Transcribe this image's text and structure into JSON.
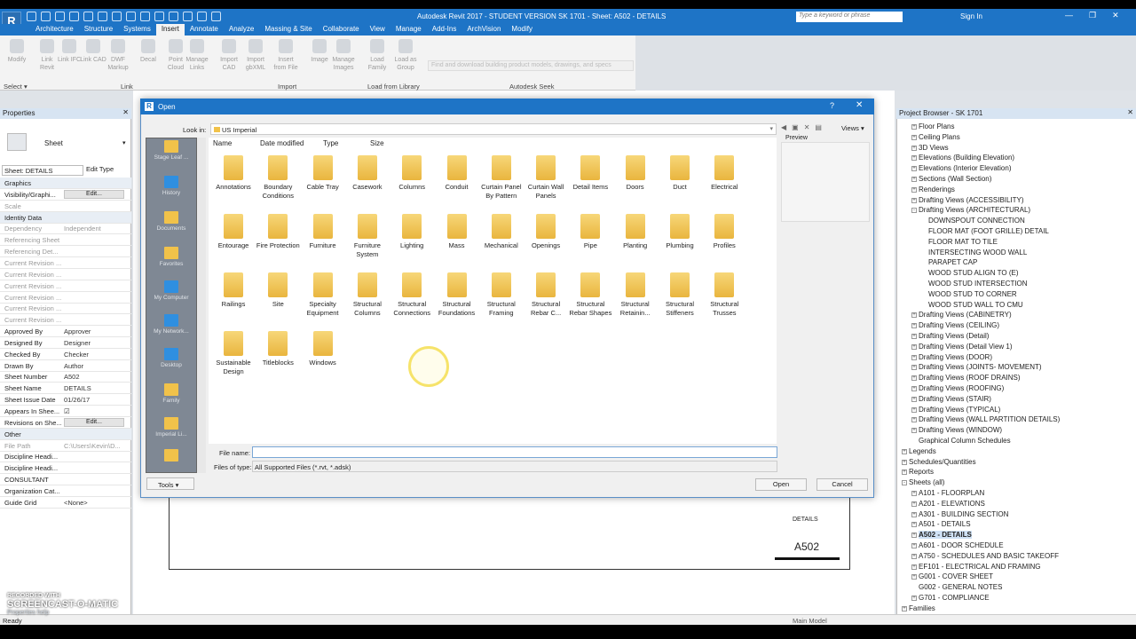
{
  "app": {
    "title": "Autodesk Revit 2017 - STUDENT VERSION    SK 1701 - Sheet: A502 - DETAILS",
    "search_placeholder": "Type a keyword or phrase",
    "sign_in": "Sign In",
    "app_button": "R"
  },
  "ribbon": {
    "tabs": [
      "Architecture",
      "Structure",
      "Systems",
      "Insert",
      "Annotate",
      "Analyze",
      "Massing & Site",
      "Collaborate",
      "View",
      "Manage",
      "Add-Ins",
      "ArchVision",
      "Modify"
    ],
    "active_tab": "Insert",
    "buttons": [
      {
        "label": "Modify"
      },
      {
        "label": "Link Revit"
      },
      {
        "label": "Link IFC"
      },
      {
        "label": "Link CAD"
      },
      {
        "label": "DWF Markup"
      },
      {
        "label": "Decal"
      },
      {
        "label": "Point Cloud"
      },
      {
        "label": "Manage Links"
      },
      {
        "label": "Import CAD"
      },
      {
        "label": "Import gbXML"
      },
      {
        "label": "Insert from File"
      },
      {
        "label": "Image"
      },
      {
        "label": "Manage Images"
      },
      {
        "label": "Load Family"
      },
      {
        "label": "Load as Group"
      }
    ],
    "groups": {
      "select": "Select",
      "link": "Link",
      "import": "Import",
      "load": "Load from Library",
      "seek": "Autodesk Seek"
    },
    "seek_placeholder": "Find and download building product models, drawings, and specs"
  },
  "properties": {
    "title": "Properties",
    "type_name": "Sheet",
    "selector": "Sheet: DETAILS",
    "edit_type": "Edit Type",
    "rows": [
      {
        "k": "Graphics",
        "v": "",
        "sec": true
      },
      {
        "k": "Visibility/Graphi...",
        "v": "",
        "btn": "Edit..."
      },
      {
        "k": "Scale",
        "v": "",
        "dim": true
      },
      {
        "k": "Identity Data",
        "v": "",
        "sec": true
      },
      {
        "k": "Dependency",
        "v": "Independent",
        "dim": true
      },
      {
        "k": "Referencing Sheet",
        "v": "",
        "dim": true
      },
      {
        "k": "Referencing Det...",
        "v": "",
        "dim": true
      },
      {
        "k": "Current Revision ...",
        "v": "",
        "dim": true
      },
      {
        "k": "Current Revision ...",
        "v": "",
        "dim": true
      },
      {
        "k": "Current Revision ...",
        "v": "",
        "dim": true
      },
      {
        "k": "Current Revision ...",
        "v": "",
        "dim": true
      },
      {
        "k": "Current Revision ...",
        "v": "",
        "dim": true
      },
      {
        "k": "Current Revision ...",
        "v": "",
        "dim": true
      },
      {
        "k": "Approved By",
        "v": "Approver"
      },
      {
        "k": "Designed By",
        "v": "Designer"
      },
      {
        "k": "Checked By",
        "v": "Checker"
      },
      {
        "k": "Drawn By",
        "v": "Author"
      },
      {
        "k": "Sheet Number",
        "v": "A502"
      },
      {
        "k": "Sheet Name",
        "v": "DETAILS"
      },
      {
        "k": "Sheet Issue Date",
        "v": "01/26/17"
      },
      {
        "k": "Appears In Shee...",
        "v": "☑"
      },
      {
        "k": "Revisions on She...",
        "v": "",
        "btn": "Edit..."
      },
      {
        "k": "Other",
        "v": "",
        "sec": true
      },
      {
        "k": "File Path",
        "v": "C:\\Users\\Kevin\\D...",
        "dim": true
      },
      {
        "k": "Discipline Headi...",
        "v": ""
      },
      {
        "k": "Discipline Headi...",
        "v": ""
      },
      {
        "k": "CONSULTANT",
        "v": ""
      },
      {
        "k": "Organization Cat...",
        "v": ""
      },
      {
        "k": "Guide Grid",
        "v": "<None>"
      }
    ]
  },
  "sheet": {
    "details": "DETAILS",
    "number": "A502"
  },
  "project_browser": {
    "title": "Project Browser - SK 1701",
    "items": [
      {
        "t": "Floor Plans",
        "l": 1,
        "x": "+"
      },
      {
        "t": "Ceiling Plans",
        "l": 1,
        "x": "+"
      },
      {
        "t": "3D Views",
        "l": 1,
        "x": "+"
      },
      {
        "t": "Elevations (Building Elevation)",
        "l": 1,
        "x": "+"
      },
      {
        "t": "Elevations (Interior Elevation)",
        "l": 1,
        "x": "+"
      },
      {
        "t": "Sections (Wall Section)",
        "l": 1,
        "x": "+"
      },
      {
        "t": "Renderings",
        "l": 1,
        "x": "+"
      },
      {
        "t": "Drafting Views (ACCESSIBILITY)",
        "l": 1,
        "x": "+"
      },
      {
        "t": "Drafting Views (ARCHITECTURAL)",
        "l": 1,
        "x": "-"
      },
      {
        "t": "DOWNSPOUT CONNECTION",
        "l": 2
      },
      {
        "t": "FLOOR MAT (FOOT GRILLE) DETAIL",
        "l": 2
      },
      {
        "t": "FLOOR MAT TO TILE",
        "l": 2
      },
      {
        "t": "INTERSECTING WOOD WALL",
        "l": 2
      },
      {
        "t": "PARAPET CAP",
        "l": 2
      },
      {
        "t": "WOOD STUD ALIGN TO (E)",
        "l": 2
      },
      {
        "t": "WOOD STUD INTERSECTION",
        "l": 2
      },
      {
        "t": "WOOD STUD TO CORNER",
        "l": 2
      },
      {
        "t": "WOOD STUD WALL TO CMU",
        "l": 2
      },
      {
        "t": "Drafting Views (CABINETRY)",
        "l": 1,
        "x": "+"
      },
      {
        "t": "Drafting Views (CEILING)",
        "l": 1,
        "x": "+"
      },
      {
        "t": "Drafting Views (Detail)",
        "l": 1,
        "x": "+"
      },
      {
        "t": "Drafting Views (Detail View 1)",
        "l": 1,
        "x": "+"
      },
      {
        "t": "Drafting Views (DOOR)",
        "l": 1,
        "x": "+"
      },
      {
        "t": "Drafting Views (JOINTS- MOVEMENT)",
        "l": 1,
        "x": "+"
      },
      {
        "t": "Drafting Views (ROOF DRAINS)",
        "l": 1,
        "x": "+"
      },
      {
        "t": "Drafting Views (ROOFING)",
        "l": 1,
        "x": "+"
      },
      {
        "t": "Drafting Views (STAIR)",
        "l": 1,
        "x": "+"
      },
      {
        "t": "Drafting Views (TYPICAL)",
        "l": 1,
        "x": "+"
      },
      {
        "t": "Drafting Views (WALL PARTITION DETAILS)",
        "l": 1,
        "x": "+"
      },
      {
        "t": "Drafting Views (WINDOW)",
        "l": 1,
        "x": "+"
      },
      {
        "t": "Graphical Column Schedules",
        "l": 1
      },
      {
        "t": "Legends",
        "l": 0,
        "x": "+"
      },
      {
        "t": "Schedules/Quantities",
        "l": 0,
        "x": "+"
      },
      {
        "t": "Reports",
        "l": 0,
        "x": "+"
      },
      {
        "t": "Sheets (all)",
        "l": 0,
        "x": "-"
      },
      {
        "t": "A101 - FLOORPLAN",
        "l": 1,
        "x": "+"
      },
      {
        "t": "A201 - ELEVATIONS",
        "l": 1,
        "x": "+"
      },
      {
        "t": "A301 - BUILDING SECTION",
        "l": 1,
        "x": "+"
      },
      {
        "t": "A501 - DETAILS",
        "l": 1,
        "x": "+"
      },
      {
        "t": "A502 - DETAILS",
        "l": 1,
        "x": "+",
        "sel": true
      },
      {
        "t": "A601 - DOOR SCHEDULE",
        "l": 1,
        "x": "+"
      },
      {
        "t": "A750 - SCHEDULES AND BASIC TAKEOFF",
        "l": 1,
        "x": "+"
      },
      {
        "t": "EF101 - ELECTRICAL AND FRAMING",
        "l": 1,
        "x": "+"
      },
      {
        "t": "G001 - COVER SHEET",
        "l": 1,
        "x": "+"
      },
      {
        "t": "G002 - GENERAL NOTES",
        "l": 1
      },
      {
        "t": "G701 - COMPLIANCE",
        "l": 1,
        "x": "+"
      },
      {
        "t": "Families",
        "l": 0,
        "x": "+"
      }
    ]
  },
  "dialog": {
    "title": "Open",
    "look_in_label": "Look in:",
    "look_in": "US Imperial",
    "views": "Views",
    "preview": "Preview",
    "columns": [
      "Name",
      "Date modified",
      "Type",
      "Size"
    ],
    "places": [
      "Stage Leaf ...",
      "History",
      "Documents",
      "Favorites",
      "My Computer",
      "My Network...",
      "Desktop",
      "Family",
      "Imperial Li...",
      ""
    ],
    "folders": [
      [
        "Annotations",
        "Boundary Conditions",
        "Cable Tray",
        "Casework",
        "Columns",
        "Conduit",
        "Curtain Panel By Pattern",
        "Curtain Wall Panels",
        "Detail Items",
        "Doors",
        "Duct",
        "Electrical"
      ],
      [
        "Entourage",
        "Fire Protection",
        "Furniture",
        "Furniture System",
        "Lighting",
        "Mass",
        "Mechanical",
        "Openings",
        "Pipe",
        "Planting",
        "Plumbing",
        "Profiles"
      ],
      [
        "Railings",
        "Site",
        "Specialty Equipment",
        "Structural Columns",
        "Structural Connections",
        "Structural Foundations",
        "Structural Framing",
        "Structural Rebar C...",
        "Structural Rebar Shapes",
        "Structural Retainin...",
        "Structural Stiffeners",
        "Structural Trusses"
      ],
      [
        "Sustainable Design",
        "Titleblocks",
        "Windows"
      ]
    ],
    "file_name_label": "File name:",
    "file_name": "",
    "files_of_type_label": "Files of type:",
    "files_of_type": "All Supported Files  (*.rvt, *.adsk)",
    "tools": "Tools",
    "open": "Open",
    "cancel": "Cancel"
  },
  "status": {
    "text": "Ready",
    "model": "Main Model"
  },
  "watermark": {
    "line1": "RECORDED WITH",
    "line2": "SCREENCAST-O-MATIC",
    "link": "Properties help"
  }
}
